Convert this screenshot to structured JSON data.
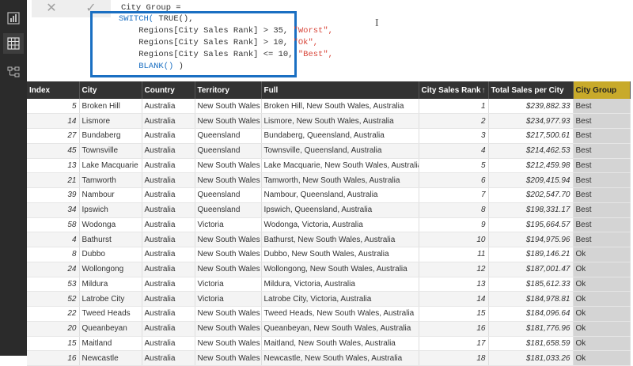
{
  "formula": {
    "line1": "City Group =",
    "code_lines": [
      {
        "fn": "SWITCH(",
        "rest": " TRUE(),",
        "str": ""
      },
      {
        "fn": "",
        "rest": "    Regions[City Sales Rank] > 35, ",
        "str": "\"Worst\","
      },
      {
        "fn": "",
        "rest": "    Regions[City Sales Rank] > 10, ",
        "str": "\"Ok\","
      },
      {
        "fn": "",
        "rest": "    Regions[City Sales Rank] <= 10, ",
        "str": "\"Best\","
      },
      {
        "fn": "    BLANK()",
        "rest": " )",
        "str": ""
      }
    ],
    "cancel_glyph": "✕",
    "commit_glyph": "✓"
  },
  "icons": {
    "rail": [
      "report-view-icon",
      "data-view-icon",
      "relationship-view-icon"
    ]
  },
  "table": {
    "columns": [
      "Index",
      "City",
      "Country",
      "Territory",
      "Full",
      "City Sales Rank",
      "Total Sales per City",
      "City Group"
    ],
    "rows": [
      [
        "5",
        "Broken Hill",
        "Australia",
        "New South Wales",
        "Broken Hill, New South Wales, Australia",
        "1",
        "$239,882.33",
        "Best"
      ],
      [
        "14",
        "Lismore",
        "Australia",
        "New South Wales",
        "Lismore, New South Wales, Australia",
        "2",
        "$234,977.93",
        "Best"
      ],
      [
        "27",
        "Bundaberg",
        "Australia",
        "Queensland",
        "Bundaberg, Queensland, Australia",
        "3",
        "$217,500.61",
        "Best"
      ],
      [
        "45",
        "Townsville",
        "Australia",
        "Queensland",
        "Townsville, Queensland, Australia",
        "4",
        "$214,462.53",
        "Best"
      ],
      [
        "13",
        "Lake Macquarie",
        "Australia",
        "New South Wales",
        "Lake Macquarie, New South Wales, Australia",
        "5",
        "$212,459.98",
        "Best"
      ],
      [
        "21",
        "Tamworth",
        "Australia",
        "New South Wales",
        "Tamworth, New South Wales, Australia",
        "6",
        "$209,415.94",
        "Best"
      ],
      [
        "39",
        "Nambour",
        "Australia",
        "Queensland",
        "Nambour, Queensland, Australia",
        "7",
        "$202,547.70",
        "Best"
      ],
      [
        "34",
        "Ipswich",
        "Australia",
        "Queensland",
        "Ipswich, Queensland, Australia",
        "8",
        "$198,331.17",
        "Best"
      ],
      [
        "58",
        "Wodonga",
        "Australia",
        "Victoria",
        "Wodonga, Victoria, Australia",
        "9",
        "$195,664.57",
        "Best"
      ],
      [
        "4",
        "Bathurst",
        "Australia",
        "New South Wales",
        "Bathurst, New South Wales, Australia",
        "10",
        "$194,975.96",
        "Best"
      ],
      [
        "8",
        "Dubbo",
        "Australia",
        "New South Wales",
        "Dubbo, New South Wales, Australia",
        "11",
        "$189,146.21",
        "Ok"
      ],
      [
        "24",
        "Wollongong",
        "Australia",
        "New South Wales",
        "Wollongong, New South Wales, Australia",
        "12",
        "$187,001.47",
        "Ok"
      ],
      [
        "53",
        "Mildura",
        "Australia",
        "Victoria",
        "Mildura, Victoria, Australia",
        "13",
        "$185,612.33",
        "Ok"
      ],
      [
        "52",
        "Latrobe City",
        "Australia",
        "Victoria",
        "Latrobe City, Victoria, Australia",
        "14",
        "$184,978.81",
        "Ok"
      ],
      [
        "22",
        "Tweed Heads",
        "Australia",
        "New South Wales",
        "Tweed Heads, New South Wales, Australia",
        "15",
        "$184,096.64",
        "Ok"
      ],
      [
        "20",
        "Queanbeyan",
        "Australia",
        "New South Wales",
        "Queanbeyan, New South Wales, Australia",
        "16",
        "$181,776.96",
        "Ok"
      ],
      [
        "15",
        "Maitland",
        "Australia",
        "New South Wales",
        "Maitland, New South Wales, Australia",
        "17",
        "$181,658.59",
        "Ok"
      ],
      [
        "16",
        "Newcastle",
        "Australia",
        "New South Wales",
        "Newcastle, New South Wales, Australia",
        "18",
        "$181,033.26",
        "Ok"
      ]
    ]
  },
  "colors": {
    "accent": "#1a6fc2",
    "selected_column": "#c8aa2a",
    "header_bg": "#333333"
  }
}
